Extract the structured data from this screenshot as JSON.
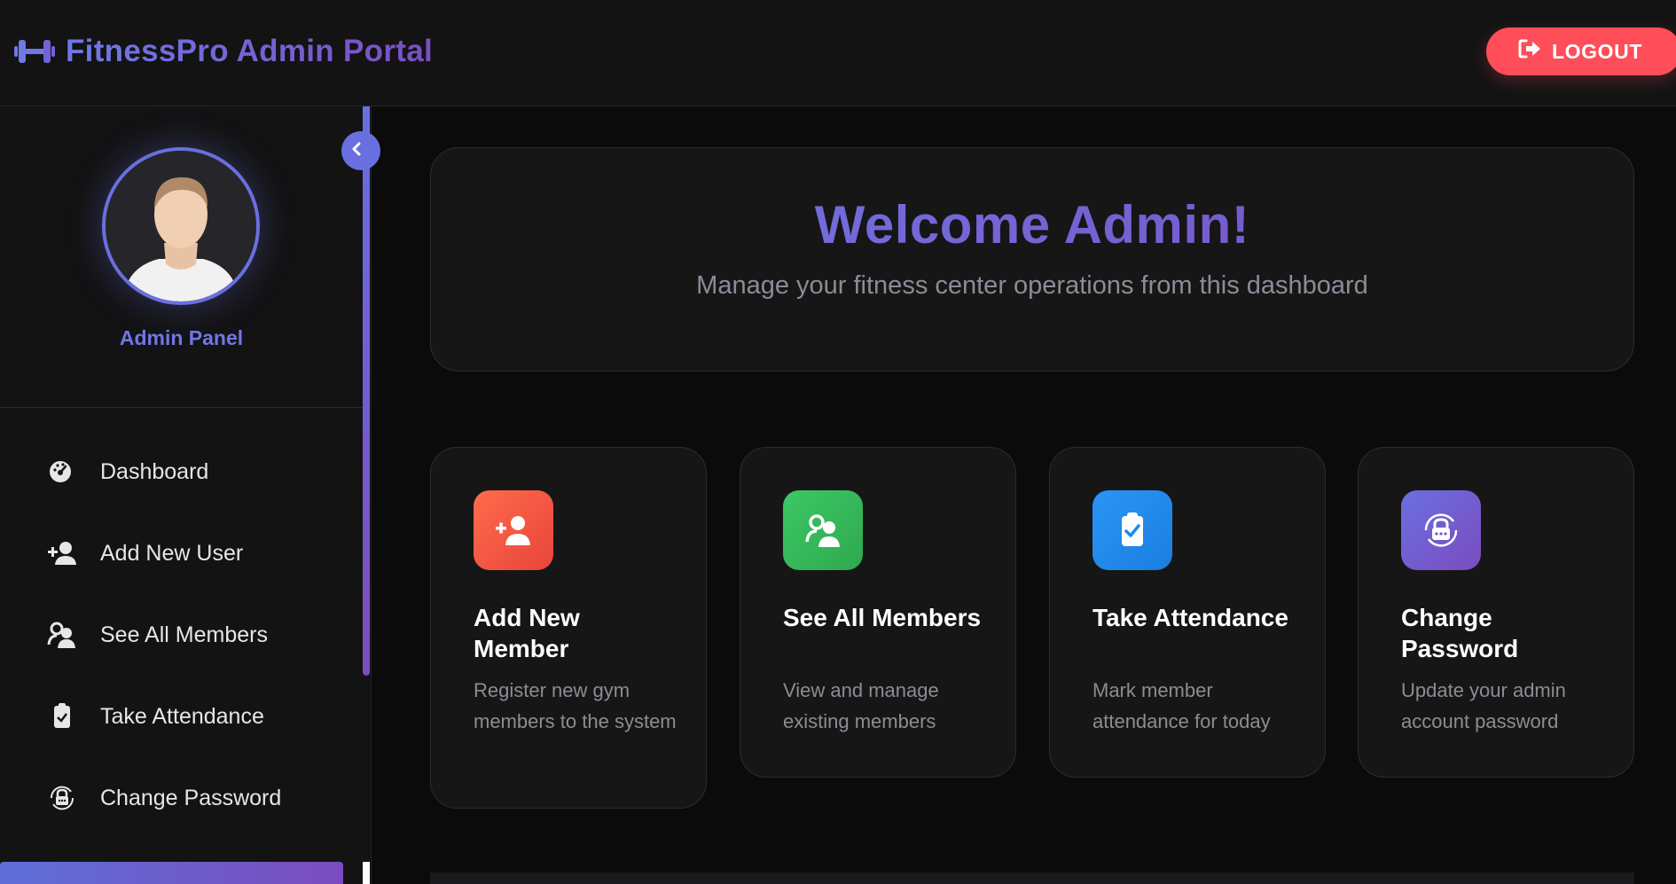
{
  "header": {
    "brand_title": "FitnessPro Admin Portal",
    "logout_label": "LOGOUT"
  },
  "sidebar": {
    "panel_label": "Admin Panel",
    "items": [
      {
        "label": "Dashboard",
        "icon": "dashboard-gauge-icon"
      },
      {
        "label": "Add New User",
        "icon": "user-plus-icon"
      },
      {
        "label": "See All Members",
        "icon": "users-icon"
      },
      {
        "label": "Take Attendance",
        "icon": "clipboard-check-icon"
      },
      {
        "label": "Change Password",
        "icon": "lock-rotate-icon"
      }
    ]
  },
  "main": {
    "welcome_title": "Welcome Admin!",
    "welcome_subtitle": "Manage your fitness center operations from this dashboard",
    "cards": [
      {
        "title": "Add New Member",
        "description": "Register new gym members to the system",
        "icon": "user-plus-icon",
        "color": "#f2553e"
      },
      {
        "title": "See All Members",
        "description": "View and manage existing members",
        "icon": "users-icon",
        "color": "#34b85a"
      },
      {
        "title": "Take Attendance",
        "description": "Mark member attendance for today",
        "icon": "clipboard-check-icon",
        "color": "#1f8af0"
      },
      {
        "title": "Change Password",
        "description": "Update your admin account password",
        "icon": "lock-rotate-icon",
        "color": "#6a5ad0"
      }
    ]
  },
  "colors": {
    "accent": "#6a6fe0",
    "accent_purple": "#7b4cbf",
    "logout_red": "#ff4d5a",
    "background": "#0b0b0c",
    "panel": "#131314"
  }
}
